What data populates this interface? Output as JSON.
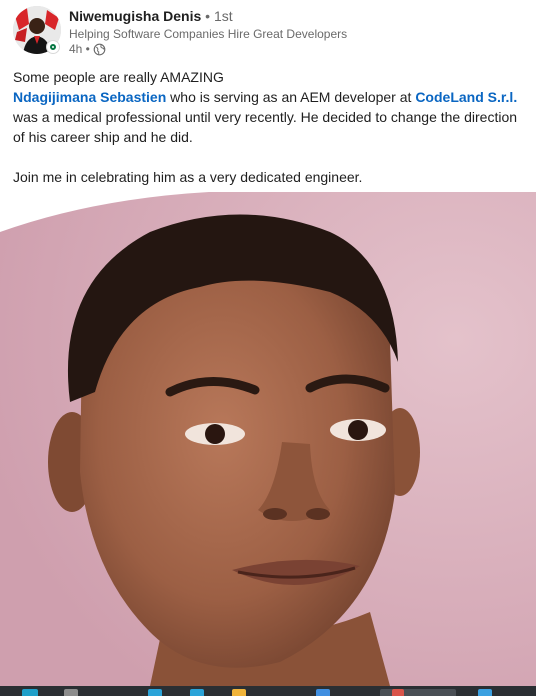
{
  "post": {
    "author": {
      "name": "Niwemugisha Denis",
      "degree": "• 1st",
      "headline": "Helping Software Companies Hire Great Developers",
      "time": "4h •",
      "visibility_icon": "globe-icon",
      "online_status": "online"
    },
    "body": {
      "line1": "Some people are really AMAZING",
      "mention_person": "Ndagijimana Sebastien",
      "text_middle": " who is serving as an AEM developer at ",
      "mention_company": "CodeLand S.r.l.",
      "text_after": "was a medical professional until very recently. He decided to change the direction of his career ship and he did.",
      "closing": "Join me in celebrating him as a very dedicated engineer."
    },
    "image": {
      "subject": "portrait-photo",
      "background_color": "#dbb2bd"
    }
  },
  "colors": {
    "link": "#0a66c2",
    "secondary_text": "#6a6a6a",
    "online": "#057642"
  }
}
